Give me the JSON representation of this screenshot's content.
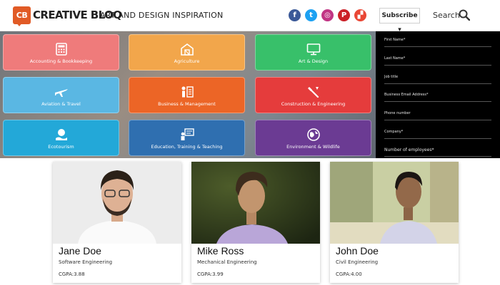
{
  "header": {
    "logo_mark": "CB",
    "logo_text": "CREATIVE BLOQ",
    "tagline": "ART AND DESIGN INSPIRATION",
    "social": [
      {
        "name": "facebook-icon",
        "glyph": "f",
        "color": "#3b5998"
      },
      {
        "name": "twitter-icon",
        "glyph": "t",
        "color": "#1da1f2"
      },
      {
        "name": "instagram-icon",
        "glyph": "◎",
        "color": "#c13584"
      },
      {
        "name": "pinterest-icon",
        "glyph": "P",
        "color": "#cb2027"
      },
      {
        "name": "flipboard-icon",
        "glyph": "▞",
        "color": "#e94735"
      }
    ],
    "subscribe_label": "Subscribe ▾",
    "search_label": "Search"
  },
  "categories": [
    {
      "label": "Accounting & Bookkeeping",
      "color": "#ef7b7b",
      "icon": "calculator-icon"
    },
    {
      "label": "Agriculture",
      "color": "#f2a64b",
      "icon": "barn-icon"
    },
    {
      "label": "Art & Design",
      "color": "#38c06a",
      "icon": "monitor-icon"
    },
    {
      "label": "Aviation & Travel",
      "color": "#5ab7e3",
      "icon": "airplane-icon"
    },
    {
      "label": "Business & Management",
      "color": "#ec6526",
      "icon": "people-chart-icon"
    },
    {
      "label": "Construction & Engineering",
      "color": "#e53c3c",
      "icon": "tools-icon"
    },
    {
      "label": "Ecotourism",
      "color": "#23a8d8",
      "icon": "hand-earth-icon"
    },
    {
      "label": "Education, Training & Teaching",
      "color": "#2f6fb0",
      "icon": "teacher-board-icon"
    },
    {
      "label": "Environment & Wildlife",
      "color": "#6b3b93",
      "icon": "globe-icon"
    }
  ],
  "form": {
    "fields": [
      "First Name*",
      "Last Name*",
      "Job title",
      "Business Email Address*",
      "Phone number",
      "Company*",
      "Number of employees*"
    ]
  },
  "cards": [
    {
      "name": "Jane Doe",
      "major": "Software Engineering",
      "gpa": "CGPA:3.88"
    },
    {
      "name": "Mike Ross",
      "major": "Mechanical Engineering",
      "gpa": "CGPA:3.99"
    },
    {
      "name": "John Doe",
      "major": "Civil Engineering",
      "gpa": "CGPA:4.00"
    }
  ]
}
